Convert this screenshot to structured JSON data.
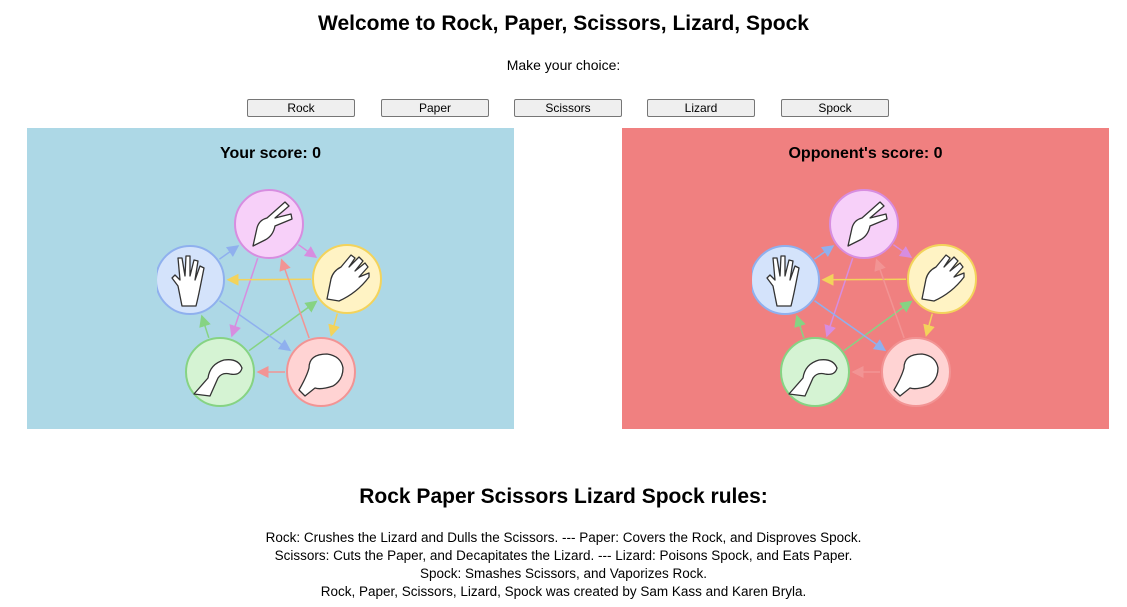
{
  "page": {
    "title": "Welcome to Rock, Paper, Scissors, Lizard, Spock",
    "subtitle": "Make your choice:"
  },
  "choices": [
    "Rock",
    "Paper",
    "Scissors",
    "Lizard",
    "Spock"
  ],
  "player_panel": {
    "score_text": "Your score: 0",
    "bg_color": "#add8e6"
  },
  "opponent_panel": {
    "score_text": "Opponent's score: 0",
    "bg_color": "#f08080"
  },
  "diagram": {
    "nodes": [
      {
        "name": "scissors",
        "fill": "#f7d0f9",
        "stroke": "#d78de0"
      },
      {
        "name": "paper",
        "fill": "#fff3c4",
        "stroke": "#f3d35b"
      },
      {
        "name": "rock",
        "fill": "#ffd3d3",
        "stroke": "#f29494"
      },
      {
        "name": "lizard",
        "fill": "#d5f3d3",
        "stroke": "#86d383"
      },
      {
        "name": "spock",
        "fill": "#d4e3fb",
        "stroke": "#8fb0ee"
      }
    ]
  },
  "rules": {
    "title": "Rock Paper Scissors Lizard Spock rules:",
    "lines": [
      "Rock: Crushes the Lizard and Dulls the Scissors. --- Paper: Covers the Rock, and Disproves Spock.",
      "Scissors: Cuts the Paper, and Decapitates the Lizard. --- Lizard: Poisons Spock, and Eats Paper.",
      "Spock: Smashes Scissors, and Vaporizes Rock.",
      "Rock, Paper, Scissors, Lizard, Spock was created by Sam Kass and Karen Bryla."
    ]
  }
}
